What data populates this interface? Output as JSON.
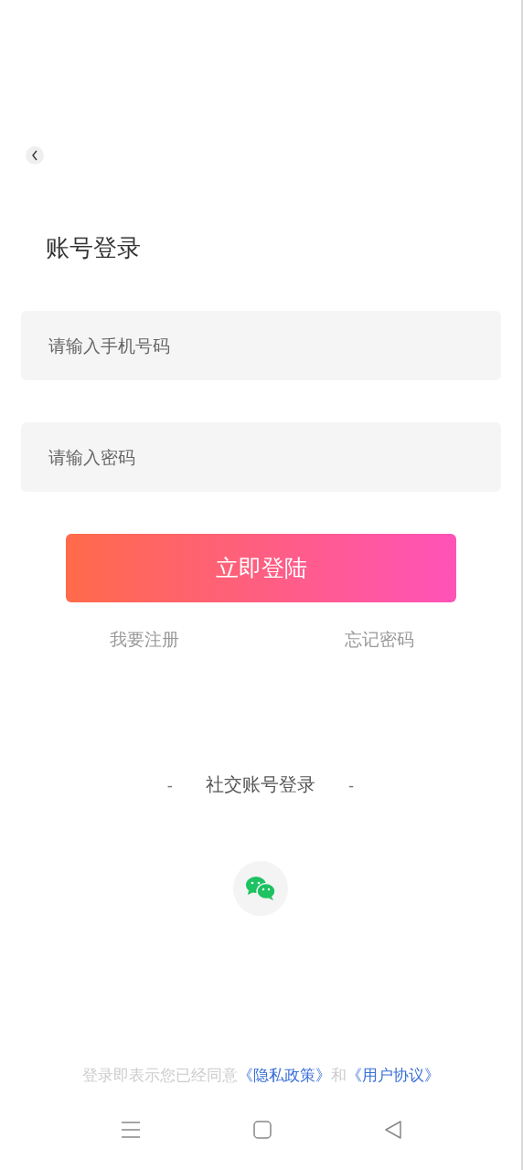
{
  "title": "账号登录",
  "fields": [
    {
      "placeholder": "请输入手机号码"
    },
    {
      "placeholder": "请输入密码"
    }
  ],
  "login_button": "立即登陆",
  "links": [
    "我要注册",
    "忘记密码"
  ],
  "social": {
    "heading": "社交账号登录",
    "dash_left": "-",
    "dash_right": "-"
  },
  "agreement": {
    "prefix": "登录即表示您已经同意",
    "links": [
      "《隐私政策》",
      "《用户协议》"
    ],
    "joiner": "和"
  }
}
